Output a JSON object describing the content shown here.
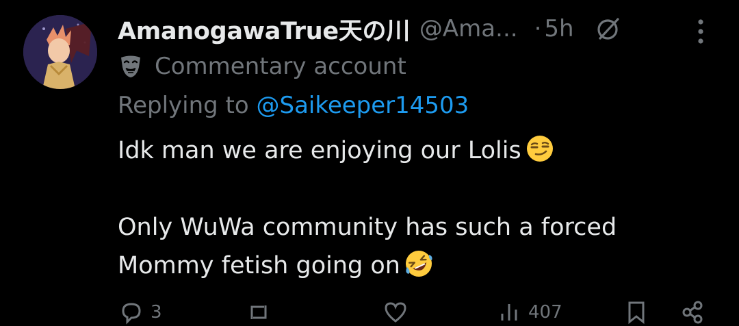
{
  "tweet": {
    "display_name": "AmanogawaTrue天の川",
    "handle": "@Ama...",
    "separator": "·",
    "time": "5h",
    "label": "Commentary account",
    "replying_prefix": "Replying to",
    "replying_to": "@Saikeeper14503",
    "body_lines": [
      "Idk man we are enjoying our Lolis",
      "",
      "Only WuWa community has such a forced",
      "Mommy fetish going on"
    ],
    "icons": {
      "grok": "grok-icon",
      "more": "more-icon",
      "label": "theater-mask-icon",
      "emoji_1": "smirking-face-emoji",
      "emoji_2": "rolling-on-floor-laughing-emoji"
    },
    "actions": {
      "reply_count": "3",
      "repost_count": "",
      "like_count": "",
      "views_count": "407"
    }
  },
  "colors": {
    "background": "#000000",
    "primary_text": "#e7e9ea",
    "secondary_text": "#71767b",
    "link": "#1d9bf0"
  }
}
